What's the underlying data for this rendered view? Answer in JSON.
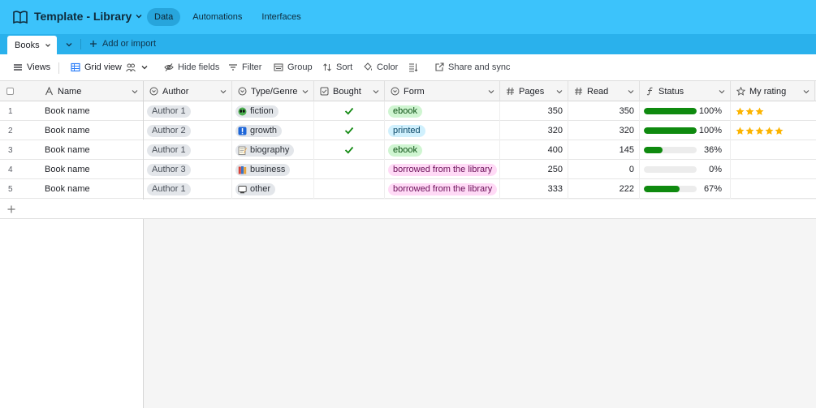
{
  "header": {
    "title": "Template - Library",
    "nav": [
      {
        "label": "Data",
        "active": true
      },
      {
        "label": "Automations",
        "active": false
      },
      {
        "label": "Interfaces",
        "active": false
      }
    ]
  },
  "tabs": {
    "active": "Books",
    "add_import": "Add or import"
  },
  "toolbar": {
    "views": "Views",
    "grid_view": "Grid view",
    "hide_fields": "Hide fields",
    "filter": "Filter",
    "group": "Group",
    "sort": "Sort",
    "color": "Color",
    "share": "Share and sync"
  },
  "columns": {
    "name": "Name",
    "author": "Author",
    "type": "Type/Genre",
    "bought": "Bought",
    "form": "Form",
    "pages": "Pages",
    "read": "Read",
    "status": "Status",
    "rating": "My rating"
  },
  "rows": [
    {
      "num": "1",
      "name": "Book name",
      "author": "Author 1",
      "type": "fiction",
      "type_icon": "alien-icon",
      "bought": true,
      "form": "ebook",
      "form_kind": "ebook",
      "pages": "350",
      "read": "350",
      "status": 1.0,
      "status_label": "100%",
      "rating": 3
    },
    {
      "num": "2",
      "name": "Book name",
      "author": "Author 2",
      "type": "growth",
      "type_icon": "exclamation-icon",
      "bought": true,
      "form": "printed",
      "form_kind": "printed",
      "pages": "320",
      "read": "320",
      "status": 1.0,
      "status_label": "100%",
      "rating": 5
    },
    {
      "num": "3",
      "name": "Book name",
      "author": "Author 1",
      "type": "biography",
      "type_icon": "memo-icon",
      "bought": true,
      "form": "ebook",
      "form_kind": "ebook",
      "pages": "400",
      "read": "145",
      "status": 0.36,
      "status_label": "36%",
      "rating": 0
    },
    {
      "num": "4",
      "name": "Book name",
      "author": "Author 3",
      "type": "business",
      "type_icon": "books-icon",
      "bought": false,
      "form": "borrowed from the library",
      "form_kind": "library",
      "pages": "250",
      "read": "0",
      "status": 0.0,
      "status_label": "0%",
      "rating": 0
    },
    {
      "num": "5",
      "name": "Book name",
      "author": "Author 1",
      "type": "other",
      "type_icon": "screen-icon",
      "bought": false,
      "form": "borrowed from the library",
      "form_kind": "library",
      "pages": "333",
      "read": "222",
      "status": 0.67,
      "status_label": "67%",
      "rating": 0
    }
  ],
  "colors": {
    "topbar": "#3cc3fb",
    "tabbar": "#2ab1ec",
    "progress": "#0f8a0f",
    "star": "#fcb400",
    "check": "#138a13"
  }
}
